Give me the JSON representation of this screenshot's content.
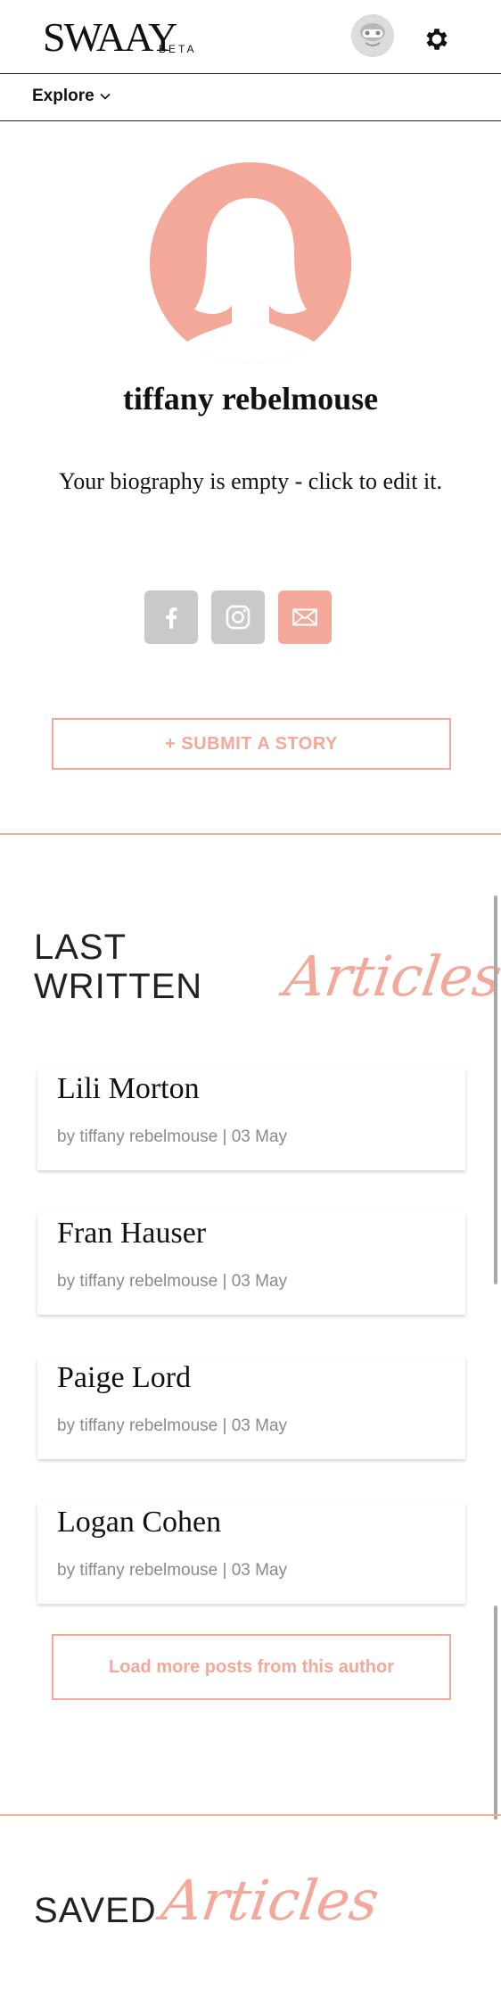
{
  "header": {
    "logo": "SWAAY",
    "beta": "BETA",
    "settings_icon": "gear-icon",
    "user_icon": "user-avatar-icon"
  },
  "subnav": {
    "explore_label": "Explore",
    "icon": "chevron-down-icon"
  },
  "profile": {
    "name": "tiffany rebelmouse",
    "bio": "Your biography is empty - click to edit it.",
    "avatar_icon": "person-silhouette-icon",
    "social": [
      {
        "name": "facebook",
        "icon": "facebook-icon"
      },
      {
        "name": "instagram",
        "icon": "instagram-icon"
      },
      {
        "name": "email",
        "icon": "mail-icon"
      }
    ],
    "submit_label": "+ SUBMIT A STORY"
  },
  "last_written": {
    "caps": "LAST WRITTEN",
    "script": "Articles",
    "articles": [
      {
        "title": "Lili Morton",
        "meta": "by tiffany rebelmouse | 03 May"
      },
      {
        "title": "Fran Hauser",
        "meta": "by tiffany rebelmouse | 03 May"
      },
      {
        "title": "Paige Lord",
        "meta": "by tiffany rebelmouse | 03 May"
      },
      {
        "title": "Logan Cohen",
        "meta": "by tiffany rebelmouse | 03 May"
      }
    ],
    "load_more_label": "Load more posts from this author"
  },
  "saved": {
    "caps": "SAVED",
    "script": "Articles"
  },
  "colors": {
    "accent": "#f3a89a",
    "social_gray": "#c9c9c9",
    "text": "#111111",
    "meta": "#8a8a8a"
  }
}
